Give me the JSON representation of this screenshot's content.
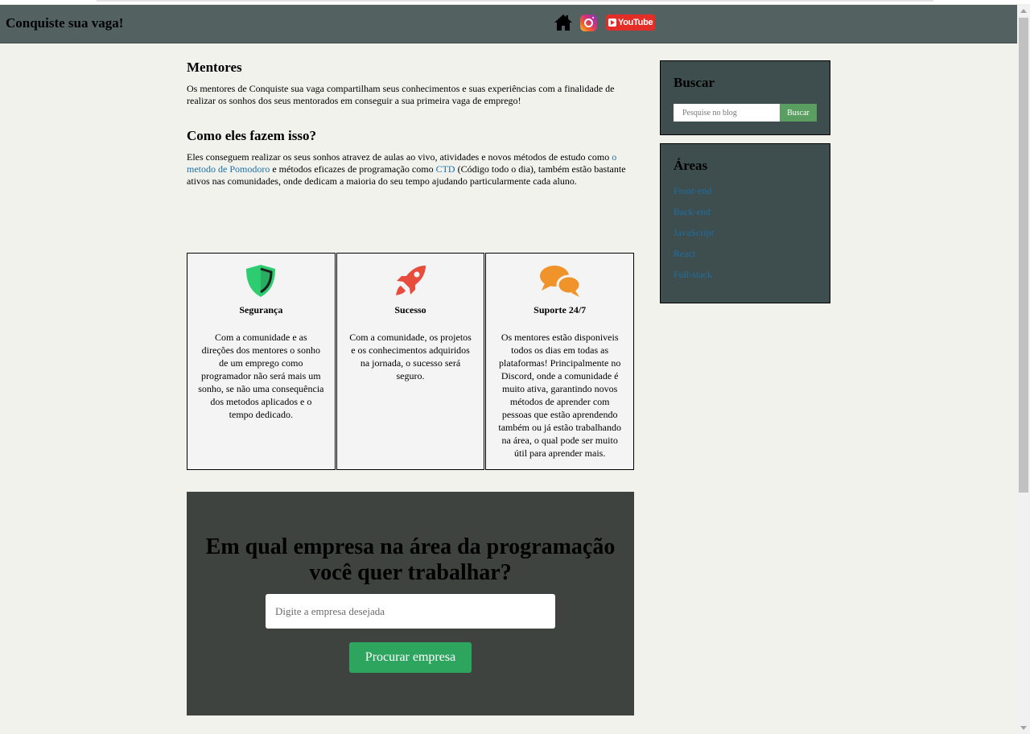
{
  "header": {
    "brand": "Conquiste sua vaga!",
    "icons": [
      "home-icon",
      "instagram-icon",
      "youtube-icon"
    ],
    "youtube_label": "YouTube"
  },
  "main": {
    "section1": {
      "title": "Mentores",
      "text": "Os mentores de Conquiste sua vaga compartilham seus conhecimentos e suas experiências com a finalidade de realizar os sonhos dos seus mentorados em conseguir a sua primeira vaga de emprego!"
    },
    "section2": {
      "title": "Como eles fazem isso?",
      "text_part1": "Eles conseguem realizar os seus sonhos atravez de aulas ao vivo, atividades e novos métodos de estudo como ",
      "link1": "o metodo de Pomodoro",
      "text_part2": " e métodos eficazes de programação como ",
      "link2": "CTD",
      "text_part3": " (Código todo o dia), também estão bastante ativos nas comunidades, onde dedicam a maioria do seu tempo ajudando particularmente cada aluno."
    },
    "features": [
      {
        "icon": "shield-icon",
        "title": "Segurança",
        "text": "Com a comunidade e as direções dos mentores o sonho de um emprego como programador não será mais um sonho, se não uma consequência dos metodos aplicados e o tempo dedicado."
      },
      {
        "icon": "rocket-icon",
        "title": "Sucesso",
        "text": "Com a comunidade, os projetos e os conhecimentos adquiridos na jornada, o sucesso será seguro."
      },
      {
        "icon": "chat-bubbles-icon",
        "title": "Suporte 24/7",
        "text": "Os mentores estão disponiveis todos os dias em todas as plataformas! Principalmente no Discord, onde a comunidade é muito ativa, garantindo novos métodos de aprender com pessoas que estão aprendendo também ou já estão trabalhando na área, o qual pode ser muito útil para aprender mais."
      }
    ],
    "cta": {
      "title": "Em qual empresa na área da programação você quer trabalhar?",
      "input_placeholder": "Digite a empresa desejada",
      "button_label": "Procurar empresa"
    }
  },
  "sidebar": {
    "search": {
      "title": "Buscar",
      "placeholder": "Pesquise no blog",
      "button_label": "Buscar"
    },
    "areas": {
      "title": "Áreas",
      "items": [
        "Front-end",
        "Back-end",
        "JavaScript",
        "React",
        "Full-stack"
      ]
    }
  },
  "colors": {
    "header_bg": "#546161",
    "page_bg": "#f2f2ed",
    "widget_bg": "#3e4d4d",
    "cta_bg": "#3e4340",
    "accent_green": "#2ea55f",
    "link_blue": "#1a6fa8",
    "shield_green": "#2ecc71",
    "rocket_red": "#e74c3c",
    "chat_orange": "#f0932b"
  }
}
